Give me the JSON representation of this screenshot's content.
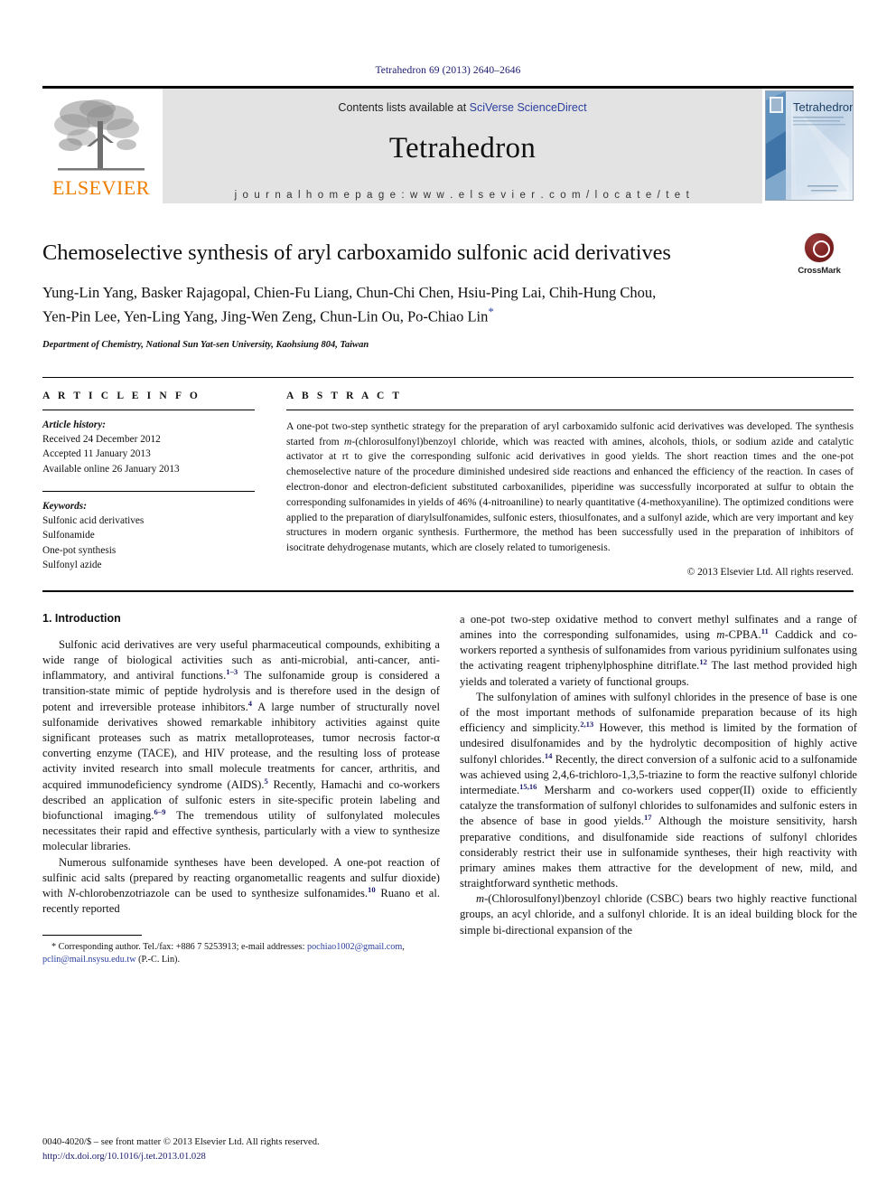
{
  "running_head": "Tetrahedron 69 (2013) 2640–2646",
  "masthead": {
    "publisher_logo_label": "ELSEVIER",
    "contents_prefix": "Contents lists available at ",
    "contents_link": "SciVerse ScienceDirect",
    "journal_title": "Tetrahedron",
    "homepage_label": "j o u r n a l   h o m e p a g e :   w w w . e l s e v i e r . c o m / l o c a t e / t e t",
    "cover_title": "Tetrahedron"
  },
  "article": {
    "title": "Chemoselective synthesis of aryl carboxamido sulfonic acid derivatives",
    "authors": "Yung-Lin Yang, Basker Rajagopal, Chien-Fu Liang, Chun-Chi Chen, Hsiu-Ping Lai, Chih-Hung Chou, Yen-Pin Lee, Yen-Ling Yang, Jing-Wen Zeng, Chun-Lin Ou, Po-Chiao Lin",
    "corresponding_marker": "*",
    "affiliation": "Department of Chemistry, National Sun Yat-sen University, Kaohsiung 804, Taiwan",
    "crossmark_label": "CrossMark"
  },
  "article_info": {
    "heading": "A R T I C L E   I N F O",
    "history_label": "Article history:",
    "history": [
      "Received 24 December 2012",
      "Accepted 11 January 2013",
      "Available online 26 January 2013"
    ],
    "keywords_label": "Keywords:",
    "keywords": [
      "Sulfonic acid derivatives",
      "Sulfonamide",
      "One-pot synthesis",
      "Sulfonyl azide"
    ]
  },
  "abstract": {
    "heading": "A B S T R A C T",
    "part1": "A one-pot two-step synthetic strategy for the preparation of aryl carboxamido sulfonic acid derivatives was developed. The synthesis started from ",
    "italic1": "m",
    "part2": "-(chlorosulfonyl)benzoyl chloride, which was reacted with amines, alcohols, thiols, or sodium azide and catalytic activator at rt to give the corresponding sulfonic acid derivatives in good yields. The short reaction times and the one-pot chemoselective nature of the procedure diminished undesired side reactions and enhanced the efficiency of the reaction. In cases of electron-donor and electron-deficient substituted carboxanilides, piperidine was successfully incorporated at sulfur to obtain the corresponding sulfonamides in yields of 46% (4-nitroaniline) to nearly quantitative (4-methoxyaniline). The optimized conditions were applied to the preparation of diarylsulfonamides, sulfonic esters, thiosulfonates, and a sulfonyl azide, which are very important and key structures in modern organic synthesis. Furthermore, the method has been successfully used in the preparation of inhibitors of isocitrate dehydrogenase mutants, which are closely related to tumorigenesis.",
    "copyright": "© 2013 Elsevier Ltd. All rights reserved."
  },
  "introduction": {
    "section_number_title": "1.  Introduction",
    "left_p1_a": "Sulfonic acid derivatives are very useful pharmaceutical compounds, exhibiting a wide range of biological activities such as anti-microbial, anti-cancer, anti-inflammatory, and antiviral functions.",
    "left_p1_ref1": "1–3",
    "left_p1_b": " The sulfonamide group is considered a transition-state mimic of peptide hydrolysis and is therefore used in the design of potent and irreversible protease inhibitors.",
    "left_p1_ref2": "4",
    "left_p1_c": " A large number of structurally novel sulfonamide derivatives showed remarkable inhibitory activities against quite significant proteases such as matrix metalloproteases, tumor necrosis factor-α converting enzyme (TACE), and HIV protease, and the resulting loss of protease activity invited research into small molecule treatments for cancer, arthritis, and acquired immunodeficiency syndrome (AIDS).",
    "left_p1_ref3": "5",
    "left_p1_d": " Recently, Hamachi and co-workers described an application of sulfonic esters in site-specific protein labeling and biofunctional imaging.",
    "left_p1_ref4": "6–9",
    "left_p1_e": " The tremendous utility of sulfonylated molecules necessitates their rapid and effective synthesis, particularly with a view to synthesize molecular libraries.",
    "left_p2_a": "Numerous sulfonamide syntheses have been developed. A one-pot reaction of sulfinic acid salts (prepared by reacting organometallic reagents and sulfur dioxide) with ",
    "left_p2_italic": "N",
    "left_p2_b": "-chlorobenzotriazole can be used to synthesize sulfonamides.",
    "left_p2_ref": "10",
    "left_p2_c": " Ruano et al. recently reported",
    "right_p1_a": "a one-pot two-step oxidative method to convert methyl sulfinates and a range of amines into the corresponding sulfonamides, using ",
    "right_p1_italic": "m",
    "right_p1_b": "-CPBA.",
    "right_p1_ref1": "11",
    "right_p1_c": " Caddick and co-workers reported a synthesis of sulfonamides from various pyridinium sulfonates using the activating reagent triphenylphosphine ditriflate.",
    "right_p1_ref2": "12",
    "right_p1_d": " The last method provided high yields and tolerated a variety of functional groups.",
    "right_p2_a": "The sulfonylation of amines with sulfonyl chlorides in the presence of base is one of the most important methods of sulfonamide preparation because of its high efficiency and simplicity.",
    "right_p2_ref1": "2,13",
    "right_p2_b": " However, this method is limited by the formation of undesired disulfonamides and by the hydrolytic decomposition of highly active sulfonyl chlorides.",
    "right_p2_ref2": "14",
    "right_p2_c": " Recently, the direct conversion of a sulfonic acid to a sulfonamide was achieved using 2,4,6-trichloro-1,3,5-triazine to form the reactive sulfonyl chloride intermediate.",
    "right_p2_ref3": "15,16",
    "right_p2_d": " Mersharm and co-workers used copper(II) oxide to efficiently catalyze the transformation of sulfonyl chlorides to sulfonamides and sulfonic esters in the absence of base in good yields.",
    "right_p2_ref4": "17",
    "right_p2_e": " Although the moisture sensitivity, harsh preparative conditions, and disulfonamide side reactions of sulfonyl chlorides considerably restrict their use in sulfonamide syntheses, their high reactivity with primary amines makes them attractive for the development of new, mild, and straightforward synthetic methods.",
    "right_p3_italic": "m",
    "right_p3_a": "-(Chlorosulfonyl)benzoyl chloride (CSBC) bears two highly reactive functional groups, an acyl chloride, and a sulfonyl chloride. It is an ideal building block for the simple bi-directional expansion of the"
  },
  "footnote": {
    "marker": "*",
    "text_a": " Corresponding author. Tel./fax: +886 7 5253913; e-mail addresses: ",
    "email1": "pochiao1002@gmail.com",
    "sep": ", ",
    "email2": "pclin@mail.nsysu.edu.tw",
    "text_b": " (P.-C. Lin)."
  },
  "page_footer": {
    "issn_line": "0040-4020/$ – see front matter © 2013 Elsevier Ltd. All rights reserved.",
    "doi": "http://dx.doi.org/10.1016/j.tet.2013.01.028"
  },
  "colors": {
    "link_blue": "#2b3fa0",
    "header_navy": "#1a1a6e",
    "elsevier_orange": "#ef7d00",
    "masthead_gray": "#e3e3e3"
  }
}
